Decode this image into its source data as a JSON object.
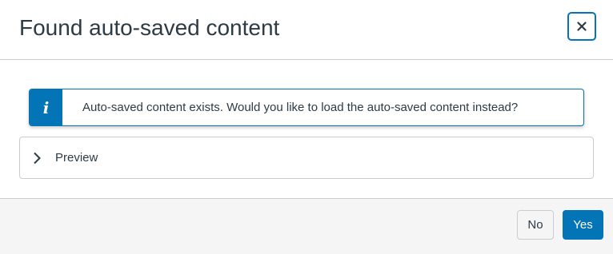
{
  "dialog": {
    "title": "Found auto-saved content",
    "close_icon": "close-icon"
  },
  "alert": {
    "icon": "info-icon",
    "icon_glyph": "i",
    "message": "Auto-saved content exists. Would you like to load the auto-saved content instead?"
  },
  "preview": {
    "icon": "chevron-right-icon",
    "label": "Preview"
  },
  "footer": {
    "no_label": "No",
    "yes_label": "Yes"
  },
  "colors": {
    "primary": "#0374b5",
    "text": "#2d3b45",
    "border": "#c7cdd1",
    "footer_bg": "#f5f5f5"
  }
}
